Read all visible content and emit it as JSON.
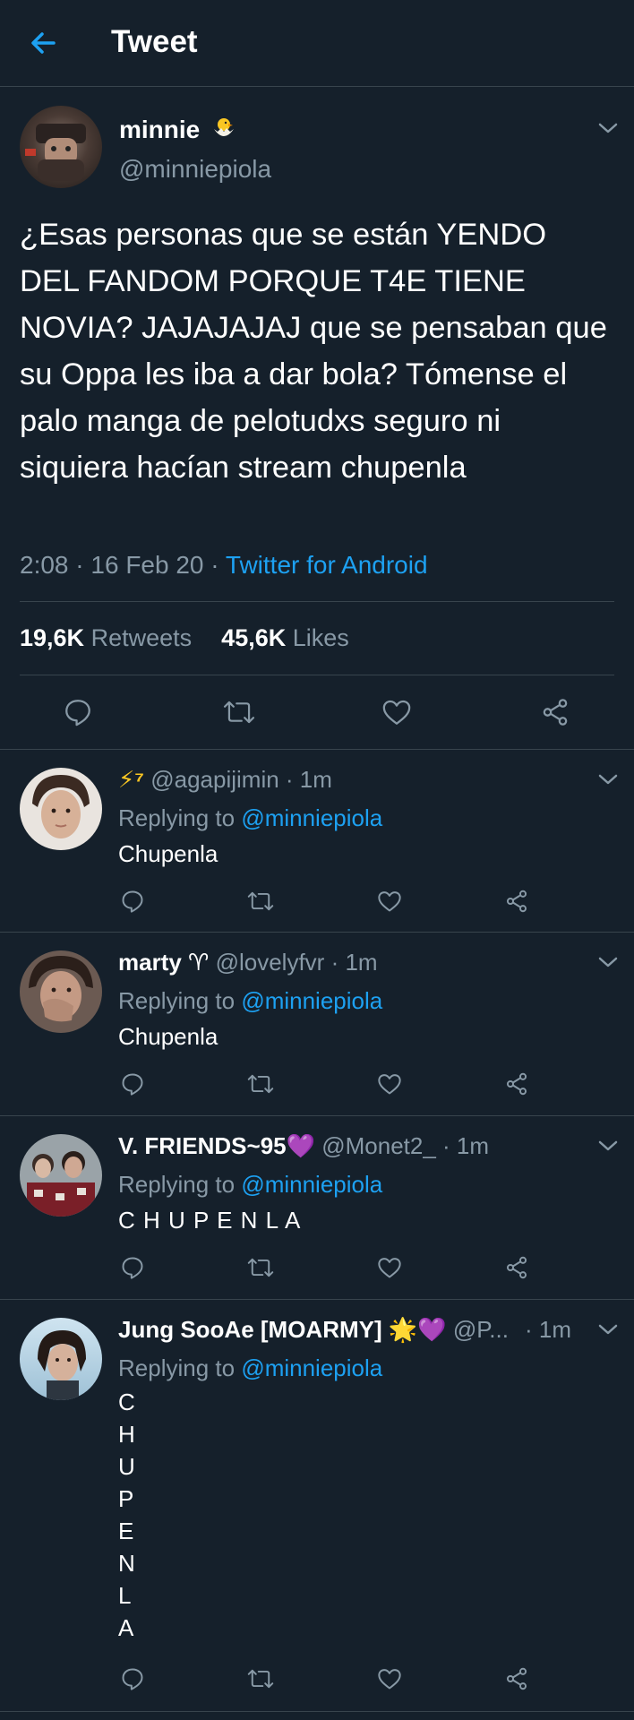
{
  "header": {
    "title": "Tweet"
  },
  "tweet": {
    "display_name": "minnie",
    "handle": "@minniepiola",
    "text": "¿Esas personas que se están YENDO DEL FANDOM PORQUE T4E TIENE NOVIA? JAJAJAJAJ que se pensaban que su Oppa les iba a dar bola? Tómense el palo manga de pelotudxs seguro ni siquiera hacían stream chupenla",
    "time": "2:08",
    "date": "16 Feb 20",
    "source": "Twitter for Android",
    "retweets_count": "19,6K",
    "retweets_label": "Retweets",
    "likes_count": "45,6K",
    "likes_label": "Likes"
  },
  "replies": [
    {
      "display_name": "⚡⁷",
      "handle": "@agapijimin",
      "time": "· 1m",
      "replying_prefix": "Replying to",
      "replying_handle": "@minniepiola",
      "text": "Chupenla"
    },
    {
      "display_name": "marty ♈",
      "handle": "@lovelyfvr",
      "time": "· 1m",
      "replying_prefix": "Replying to",
      "replying_handle": "@minniepiola",
      "text": "Chupenla"
    },
    {
      "display_name": "V. FRIENDS~95💜",
      "handle": "@Monet2_",
      "time": "· 1m",
      "replying_prefix": "Replying to",
      "replying_handle": "@minniepiola",
      "text": "C H U P E N L A"
    },
    {
      "display_name": "Jung SooAe [MOARMY] 🌟💜",
      "handle": "@P...",
      "time": "· 1m",
      "replying_prefix": "Replying to",
      "replying_handle": "@minniepiola",
      "letters": [
        "C",
        "H",
        "U",
        "P",
        "E",
        "N",
        "L",
        "A"
      ]
    }
  ],
  "colors": {
    "background": "#15202b",
    "accent": "#1da1f2",
    "muted": "#8899a6",
    "divider": "#38444d"
  },
  "icons": [
    "back-arrow-icon",
    "chevron-down-icon",
    "reply-icon",
    "retweet-icon",
    "like-icon",
    "share-icon"
  ]
}
